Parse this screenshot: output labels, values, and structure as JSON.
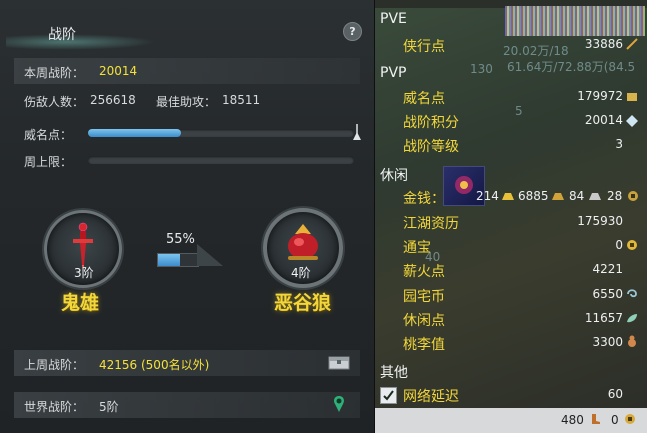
{
  "left": {
    "title": "战阶",
    "help": "?",
    "weekly": {
      "label": "本周战阶：",
      "value": "20014"
    },
    "stats": {
      "enemies_label": "伤敌人数：",
      "enemies_value": "256618",
      "assist_label": "最佳助攻：",
      "assist_value": "18511"
    },
    "fame": {
      "label": "威名点：",
      "progress": 0.35
    },
    "weekly_cap": {
      "label": "周上限：",
      "progress": 0.0
    },
    "ranks": [
      {
        "level": "3阶",
        "name": "鬼雄"
      },
      {
        "level": "4阶",
        "name": "恶谷狼"
      }
    ],
    "rank_progress": {
      "text": "55%",
      "value": 0.55
    },
    "last_week": {
      "label": "上周战阶：",
      "value": "42156 (500名以外)"
    },
    "world": {
      "label": "世界战阶：",
      "value": "5阶"
    }
  },
  "right": {
    "top_fragments": {
      "a": "20.02万/18",
      "b": "61.64万/72.88万(84.5",
      "c": "130",
      "d": "5"
    },
    "pve": {
      "header": "PVE",
      "rows": [
        {
          "label": "侠行点",
          "value": "33886"
        }
      ]
    },
    "pvp": {
      "header": "PVP",
      "rows": [
        {
          "label": "威名点",
          "value": "179972"
        },
        {
          "label": "战阶积分",
          "value": "20014"
        },
        {
          "label": "战阶等级",
          "value": "3"
        }
      ]
    },
    "leisure": {
      "header": "休闲",
      "money": {
        "label": "金钱：",
        "gold": "214",
        "silver": "6885",
        "copper": "84",
        "other": "28"
      },
      "rows": [
        {
          "label": "江湖资历",
          "value": "175930"
        },
        {
          "label": "通宝",
          "value": "0"
        },
        {
          "label": "薪火点",
          "value": "4221"
        },
        {
          "label": "园宅币",
          "value": "6550"
        },
        {
          "label": "休闲点",
          "value": "11657"
        },
        {
          "label": "桃李值",
          "value": "3300"
        }
      ]
    },
    "other": {
      "header": "其他",
      "latency_label": "网络延迟",
      "latency_value": "60",
      "checked": true
    },
    "footer": {
      "left_value": "480",
      "right_value": "0"
    },
    "under_text": "40"
  },
  "colors": {
    "accent_yellow": "#f2d73a",
    "bar_blue": "#4f9fd9"
  }
}
